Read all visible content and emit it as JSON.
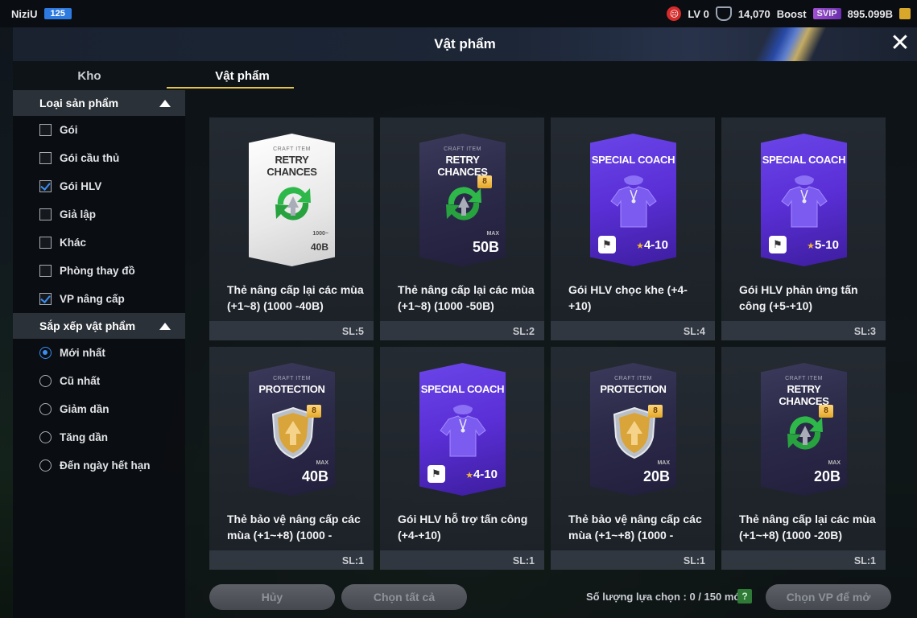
{
  "topbar": {
    "username": "NiziU",
    "user_level": "125",
    "lv_label": "LV 0",
    "trophies": "14,070",
    "boost_label": "Boost",
    "svip_label": "SVIP",
    "coins": "895.099B"
  },
  "window": {
    "title": "Vật phẩm",
    "tabs": [
      "Kho",
      "Vật phẩm"
    ],
    "active_tab": "Vật phẩm"
  },
  "sidebar": {
    "product_type_header": "Loại sản phẩm",
    "product_types": [
      {
        "label": "Gói",
        "checked": false
      },
      {
        "label": "Gói cầu thủ",
        "checked": false
      },
      {
        "label": "Gói HLV",
        "checked": true
      },
      {
        "label": "Giả lập",
        "checked": false
      },
      {
        "label": "Khác",
        "checked": false
      },
      {
        "label": "Phòng thay đồ",
        "checked": false
      },
      {
        "label": "VP nâng cấp",
        "checked": true
      }
    ],
    "sort_header": "Sắp xếp vật phẩm",
    "sort_options": [
      {
        "label": "Mới nhất",
        "selected": true
      },
      {
        "label": "Cũ nhất",
        "selected": false
      },
      {
        "label": "Giảm dần",
        "selected": false
      },
      {
        "label": "Tăng dần",
        "selected": false
      },
      {
        "label": "Đến ngày hết hạn",
        "selected": false
      }
    ]
  },
  "items": [
    {
      "name": "Thẻ nâng cấp lại các mùa (+1~8) (1000 -40B)",
      "qty": "SL:5",
      "art": {
        "style": "white",
        "sup": "CRAFT ITEM",
        "title": "RETRY CHANCES",
        "value": "40B",
        "sub": "1000~"
      }
    },
    {
      "name": "Thẻ nâng cấp lại các mùa (+1~8) (1000 -50B)",
      "qty": "SL:2",
      "art": {
        "style": "dark",
        "sup": "CRAFT ITEM",
        "title": "RETRY CHANCES",
        "value": "50B",
        "sub": "MAX",
        "badge": "8"
      }
    },
    {
      "name": "Gói HLV chọc khe (+4-+10)",
      "qty": "SL:4",
      "art": {
        "style": "purple",
        "title": "SPECIAL COACH",
        "level_star": "★",
        "level": "4-10"
      }
    },
    {
      "name": "Gói HLV phản ứng tấn công (+5-+10)",
      "qty": "SL:3",
      "art": {
        "style": "purple",
        "title": "SPECIAL COACH",
        "level_star": "★",
        "level": "5-10"
      }
    },
    {
      "name": "Thẻ bảo vệ nâng cấp các mùa (+1~+8) (1000 -",
      "qty": "SL:1",
      "art": {
        "style": "dark",
        "sup": "CRAFT ITEM",
        "title": "PROTECTION",
        "value": "40B",
        "sub": "MAX",
        "badge": "8"
      }
    },
    {
      "name": "Gói HLV hỗ trợ tấn công (+4-+10)",
      "qty": "SL:1",
      "art": {
        "style": "purple",
        "title": "SPECIAL COACH",
        "level_star": "★",
        "level": "4-10"
      }
    },
    {
      "name": "Thẻ bảo vệ nâng cấp các mùa (+1~+8) (1000 -",
      "qty": "SL:1",
      "art": {
        "style": "dark",
        "sup": "CRAFT ITEM",
        "title": "PROTECTION",
        "value": "20B",
        "sub": "MAX",
        "badge": "8"
      }
    },
    {
      "name": "Thẻ nâng cấp lại các mùa (+1~+8) (1000 -20B)",
      "qty": "SL:1",
      "art": {
        "style": "dark",
        "sup": "CRAFT ITEM",
        "title": "RETRY CHANCES",
        "value": "20B",
        "sub": "MAX",
        "badge": "8"
      }
    }
  ],
  "bottom": {
    "cancel_label": "Hủy",
    "select_all_label": "Chọn tất cả",
    "count_text": "Số lượng lựa chọn : 0 / 150 món",
    "help_label": "?",
    "open_label": "Chọn VP để mở"
  }
}
